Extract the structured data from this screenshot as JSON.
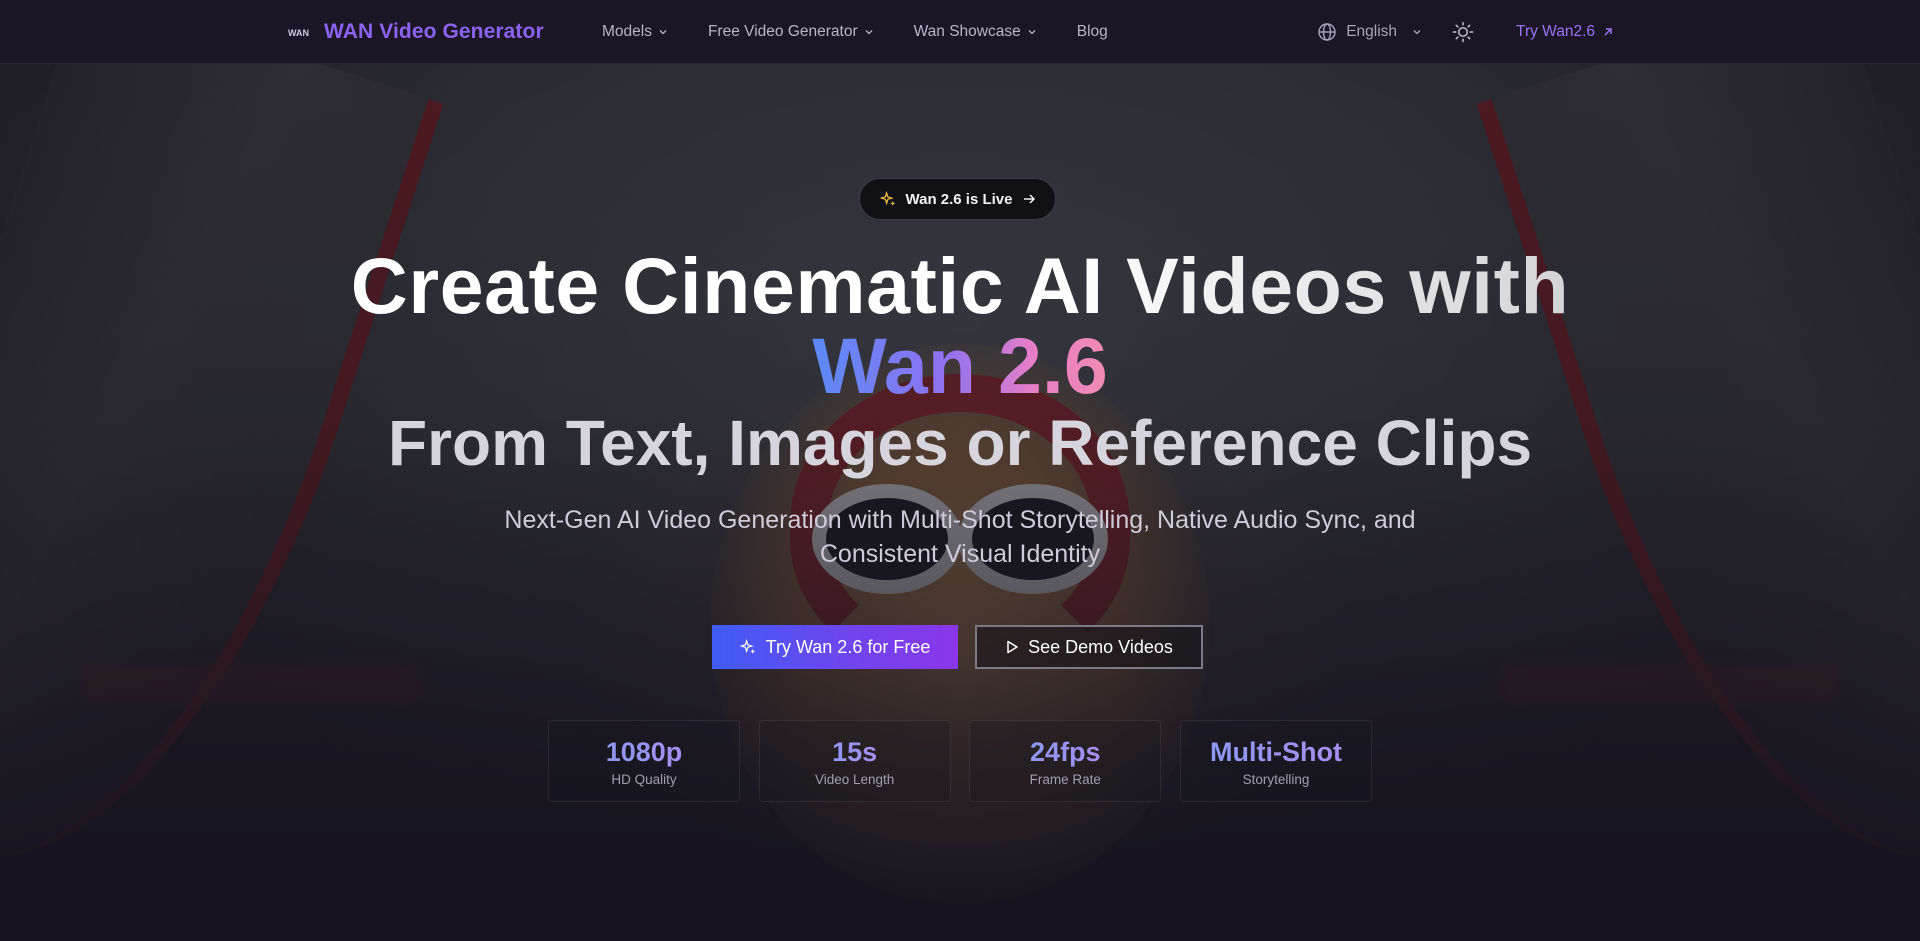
{
  "nav": {
    "brand": "WAN Video Generator",
    "brand_logo_text": "WAN",
    "menu": [
      {
        "label": "Models",
        "has_dropdown": true
      },
      {
        "label": "Free Video Generator",
        "has_dropdown": true
      },
      {
        "label": "Wan Showcase",
        "has_dropdown": true
      },
      {
        "label": "Blog",
        "has_dropdown": false
      }
    ],
    "language": "English",
    "theme_icon": "sun-icon",
    "try_link": "Try Wan2.6"
  },
  "hero": {
    "badge": "Wan 2.6 is Live",
    "title_line1": "Create Cinematic AI Videos with",
    "title_highlight": "Wan 2.6",
    "title_line3": "From Text, Images or Reference Clips",
    "subtitle": "Next-Gen AI Video Generation with Multi-Shot Storytelling, Native Audio Sync, and Consistent Visual Identity",
    "cta_primary": "Try Wan 2.6 for Free",
    "cta_secondary": "See Demo Videos",
    "stats": [
      {
        "value": "1080p",
        "label": "HD Quality"
      },
      {
        "value": "15s",
        "label": "Video Length"
      },
      {
        "value": "24fps",
        "label": "Frame Rate"
      },
      {
        "value": "Multi-Shot",
        "label": "Storytelling"
      }
    ]
  },
  "colors": {
    "brand": "#8b63f0",
    "nav_bg": "#1b1626",
    "page_bg": "#17141f",
    "cta_gradient_start": "#3f5cf5",
    "cta_gradient_end": "#8b36e8"
  }
}
